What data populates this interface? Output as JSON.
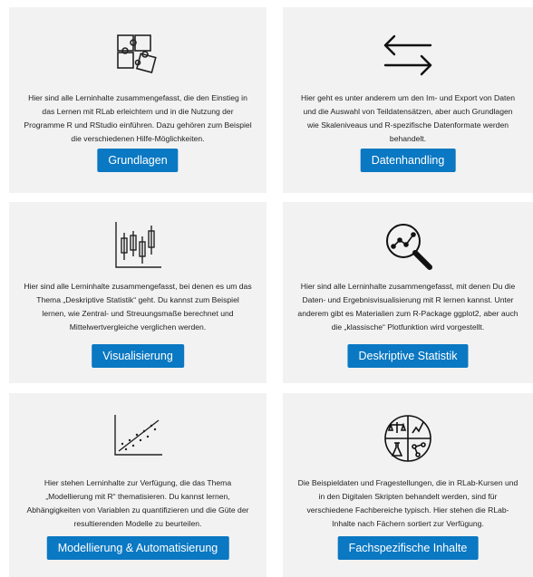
{
  "cards": [
    {
      "icon": "puzzle-icon",
      "description": "Hier sind alle Lerninhalte zusammengefasst, die den Einstieg in das Lernen mit RLab erleichtern und in die Nutzung der Programme R und RStudio einführen. Dazu gehören zum Beispiel die verschiedenen Hilfe-Möglichkeiten.",
      "button": "Grundlagen"
    },
    {
      "icon": "arrows-exchange-icon",
      "description": "Hier geht es unter anderem um den Im- und Export von Daten und die Auswahl von Teildatensätzen, aber auch Grundlagen wie Skaleniveaus und R-spezifische Datenformate werden behandelt.",
      "button": "Datenhandling"
    },
    {
      "icon": "boxplot-chart-icon",
      "description": "Hier sind alle Lerninhalte zusammengefasst, bei denen es um das Thema „Deskriptive Statistik“ geht. Du kannst zum Beispiel lernen, wie Zentral- und Streuungsmaße berechnet und Mittelwertvergleiche verglichen werden.",
      "button": "Visualisierung"
    },
    {
      "icon": "magnifier-chart-icon",
      "description": "Hier sind alle Lerninhalte zusammengefasst, mit denen Du die Daten- und Ergebnisvisualisierung mit R lernen kannst. Unter anderem gibt es Materialien zum R-Package ggplot2, aber auch die „klassische“ Plotfunktion wird vorgestellt.",
      "button": "Deskriptive Statistik"
    },
    {
      "icon": "scatter-regression-icon",
      "description": "Hier stehen Lerninhalte zur Verfügung, die das Thema „Modellierung mit R“ thematisieren. Du kannst lernen, Abhängigkeiten von Variablen zu quantifizieren und die Güte der resultierenden Modelle zu beurteilen.",
      "button": "Modellierung & Automatisierung"
    },
    {
      "icon": "subjects-circle-icon",
      "description": "Die Beispieldaten und Fragestellungen, die in RLab-Kursen und in den Digitalen Skripten behandelt werden, sind für verschiedene Fachbereiche typisch. Hier stehen die RLab-Inhalte nach Fächern sortiert zur Verfügung.",
      "button": "Fachspezifische Inhalte"
    }
  ]
}
